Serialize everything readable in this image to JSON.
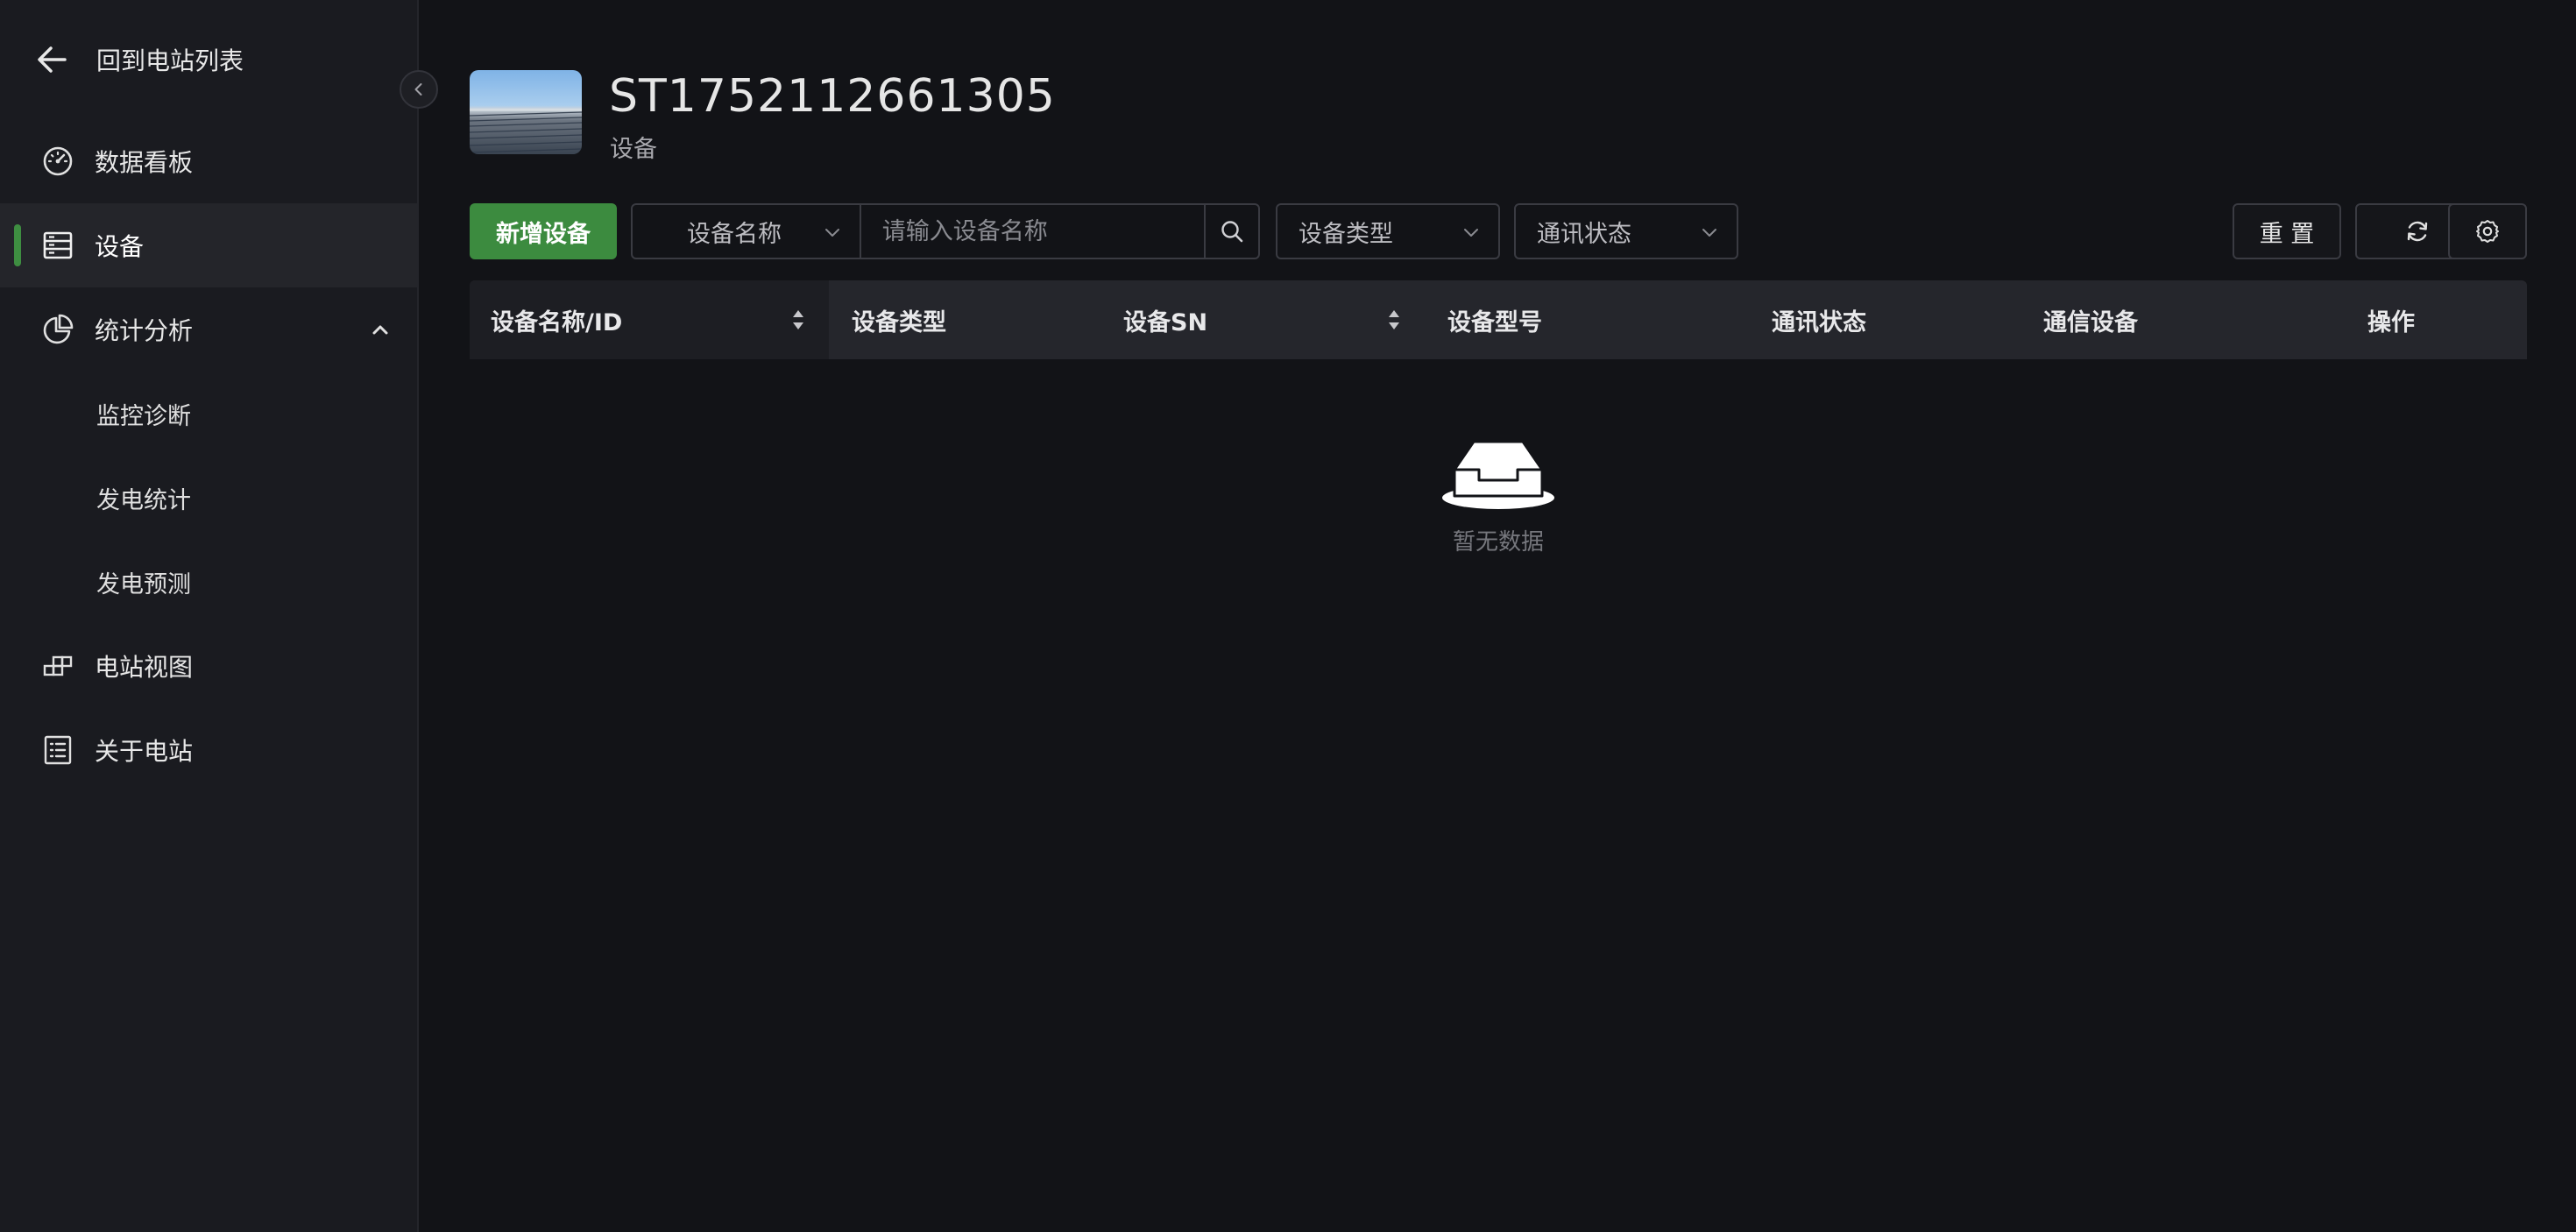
{
  "sidebar": {
    "back_label": "回到电站列表",
    "items": [
      {
        "label": "数据看板",
        "icon": "dashboard-icon"
      },
      {
        "label": "设备",
        "icon": "device-list-icon",
        "active": true
      },
      {
        "label": "统计分析",
        "icon": "pie-chart-icon",
        "expanded": true
      },
      {
        "label": "电站视图",
        "icon": "station-view-icon"
      },
      {
        "label": "关于电站",
        "icon": "about-list-icon"
      }
    ],
    "sub_items": [
      {
        "label": "监控诊断"
      },
      {
        "label": "发电统计"
      },
      {
        "label": "发电预测"
      }
    ]
  },
  "header": {
    "station_id": "ST1752112661305",
    "subtitle": "设备"
  },
  "toolbar": {
    "add_label": "新增设备",
    "search_field_select": "设备名称",
    "search_placeholder": "请输入设备名称",
    "device_type_select": "设备类型",
    "comm_status_select": "通讯状态",
    "reset_label": "重 置"
  },
  "table": {
    "columns": [
      "设备名称/ID",
      "设备类型",
      "设备SN",
      "设备型号",
      "通讯状态",
      "通信设备",
      "操作"
    ],
    "rows": [],
    "empty_text": "暂无数据"
  },
  "colors": {
    "accent": "#3c8b3f",
    "background": "#121317",
    "sidebar": "#1a1b20"
  }
}
